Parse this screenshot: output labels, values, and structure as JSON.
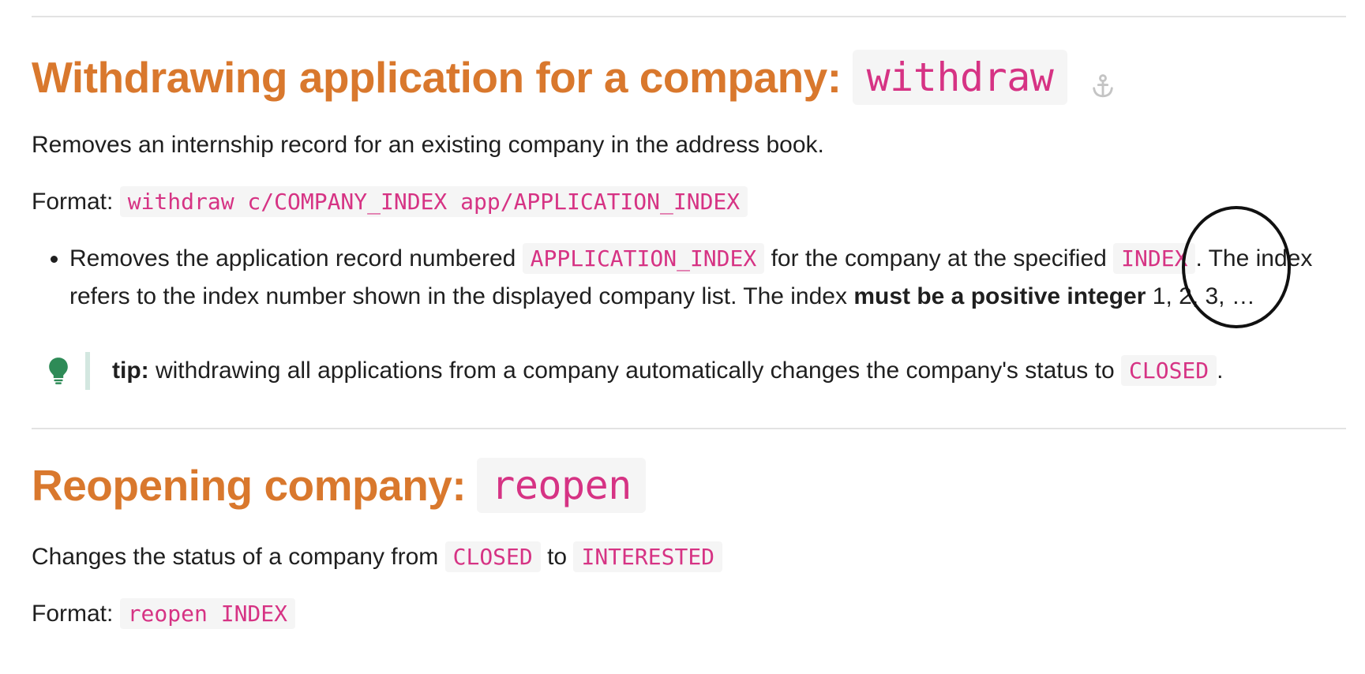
{
  "section1": {
    "heading": "Withdrawing application for a company:",
    "heading_code": "withdraw",
    "anchor_icon": "anchor-icon",
    "description": "Removes an internship record for an existing company in the address book.",
    "format_label": "Format:",
    "format_code": "withdraw c/COMPANY_INDEX app/APPLICATION_INDEX",
    "bullet": {
      "t1": "Removes the application record numbered ",
      "c1": "APPLICATION_INDEX",
      "t2": " for the company at the specified ",
      "c2": "INDEX",
      "t3": ". The index refers to the index number shown in the displayed company list. The index ",
      "bold": "must be a positive integer",
      "t4": " 1, 2, 3, …"
    },
    "tip": {
      "icon": "lightbulb-icon",
      "label": "tip:",
      "text": " withdrawing all applications from a company automatically changes the company's status to ",
      "code": "CLOSED",
      "end": "."
    }
  },
  "section2": {
    "heading": "Reopening company:",
    "heading_code": "reopen",
    "description_t1": "Changes the status of a company from ",
    "description_c1": "CLOSED",
    "description_t2": " to ",
    "description_c2": "INTERESTED",
    "format_label": "Format:",
    "format_code": "reopen INDEX"
  },
  "colors": {
    "heading": "#d9782d",
    "code_text": "#d63384",
    "code_bg": "#f5f5f5",
    "tip_icon": "#2e8b57"
  }
}
